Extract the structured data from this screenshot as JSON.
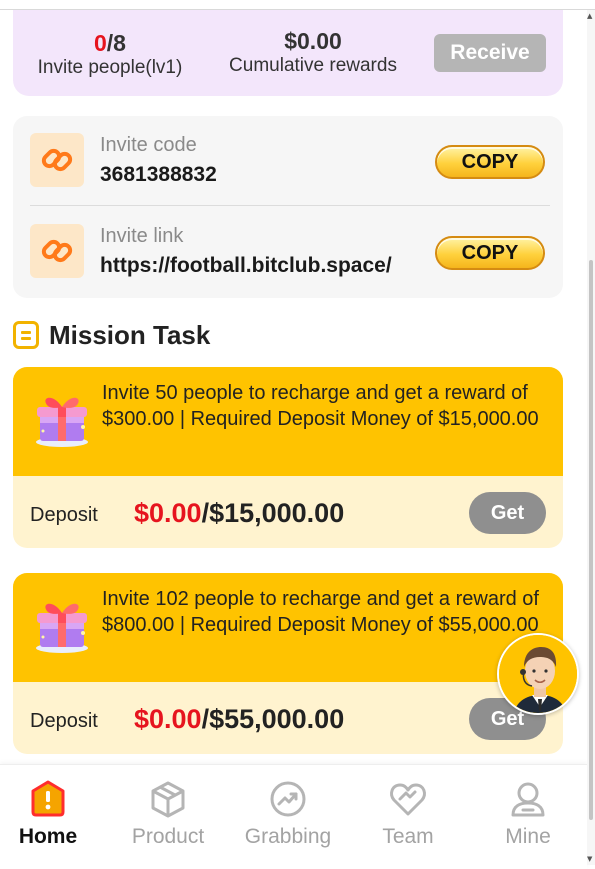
{
  "stats": {
    "invited_current": "0",
    "invited_total": "/8",
    "invite_label": "Invite people(lv1)",
    "reward_value": "$0.00",
    "reward_label": "Cumulative rewards",
    "receive_label": "Receive"
  },
  "invite": {
    "code_label": "Invite code",
    "code_value": "3681388832",
    "link_label": "Invite link",
    "link_value": "https://football.bitclub.space/",
    "copy_label": "COPY"
  },
  "mission": {
    "title": "Mission Task",
    "tasks": [
      {
        "text": "Invite 50 people to recharge and get a reward of $300.00 | Required Deposit Money of $15,000.00",
        "deposit_label": "Deposit",
        "current": "$0.00",
        "target": "/$15,000.00",
        "button": "Get"
      },
      {
        "text": "Invite 102 people to recharge and get a reward of $800.00 | Required Deposit Money of $55,000.00",
        "deposit_label": "Deposit",
        "current": "$0.00",
        "target": "/$55,000.00",
        "button": "Get"
      }
    ]
  },
  "nav": {
    "items": [
      {
        "label": "Home",
        "icon": "home-icon",
        "active": true
      },
      {
        "label": "Product",
        "icon": "box-icon",
        "active": false
      },
      {
        "label": "Grabbing",
        "icon": "trend-icon",
        "active": false
      },
      {
        "label": "Team",
        "icon": "heart-icon",
        "active": false
      },
      {
        "label": "Mine",
        "icon": "user-icon",
        "active": false
      }
    ]
  },
  "colors": {
    "accent": "#ffc300",
    "highlight": "#e6141e",
    "stats_bg": "#f3e6fb",
    "disabled_button": "#b5b5b5"
  }
}
